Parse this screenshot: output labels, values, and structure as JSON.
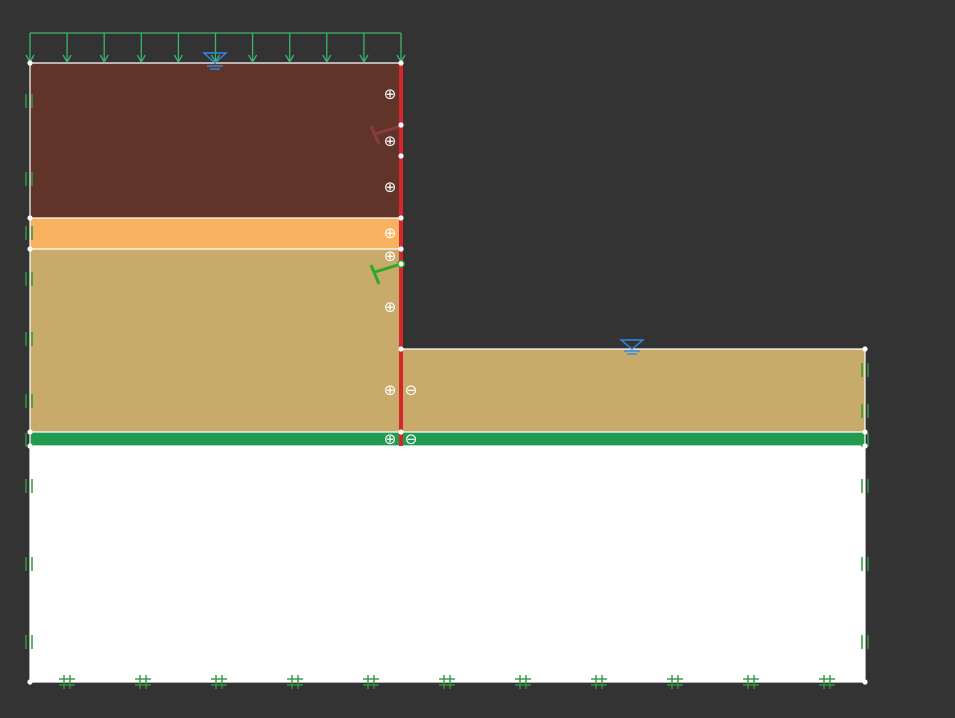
{
  "diagram": {
    "background": "#333333",
    "colors": {
      "soil_top": "#61342A",
      "soil_mid": "#F8B15E",
      "soil_main": "#C8AA6A",
      "soil_bottom": "#FFFFFF",
      "interface_layer": "#219A52",
      "wall": "#D7262B",
      "anchor_upper": "#8A3A44",
      "anchor_lower": "#31A82B",
      "support_marks": "#2E9A3C",
      "surcharge": "#3BB36F",
      "water_table": "#2E8BE6",
      "outline": "#FFFFFF",
      "node": "#FFFFFF"
    },
    "symbols": {
      "plus": "⊕",
      "minus": "⊖"
    },
    "icons": [
      "surcharge-load-icon",
      "water-table-icon",
      "anchor-icon",
      "sheet-pile-wall-icon",
      "roller-support-icon",
      "fixed-support-icon",
      "positive-interface-icon",
      "negative-interface-icon"
    ]
  }
}
